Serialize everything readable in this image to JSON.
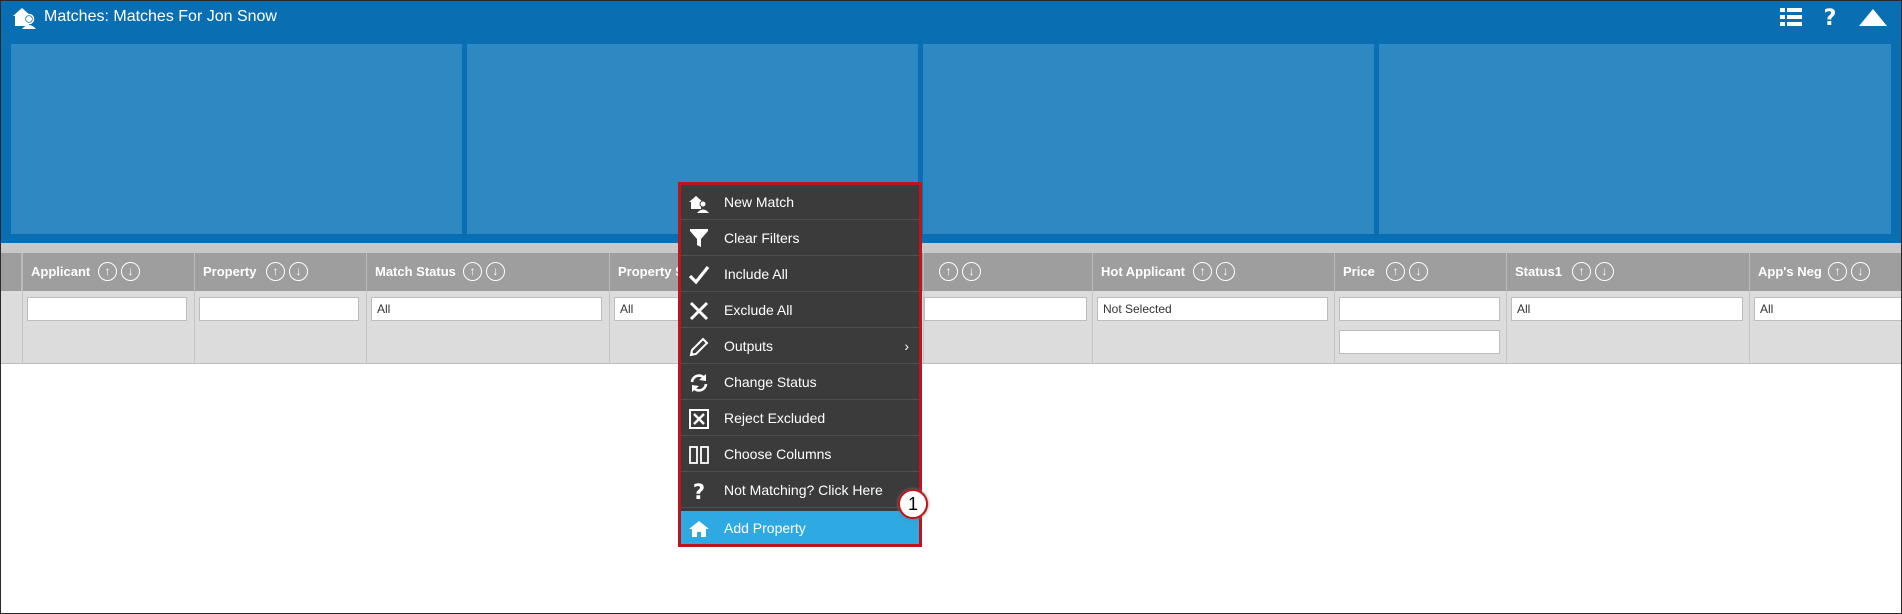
{
  "window": {
    "title": "Matches: Matches For Jon Snow"
  },
  "header_icons": [
    "list-view-icon",
    "help-icon",
    "collapse-up-icon"
  ],
  "colors": {
    "header": "#0a6fb2",
    "tile": "#2e88c2",
    "grid_header": "#9e9e9e",
    "menu_bg": "#3b3b3b",
    "menu_active": "#2ea9e2",
    "highlight": "#c0141b"
  },
  "columns": [
    {
      "title": "Applicant",
      "filter": ""
    },
    {
      "title": "Property",
      "filter": ""
    },
    {
      "title": "Match Status",
      "filter": "All"
    },
    {
      "title": "Property St",
      "filter": "All"
    },
    {
      "title": "",
      "filter": ""
    },
    {
      "title": "Hot Applicant",
      "filter": "Not Selected"
    },
    {
      "title": "Price",
      "filter": "",
      "filter2": ""
    },
    {
      "title": "Status1",
      "filter": "All"
    },
    {
      "title": "App's Neg",
      "filter": "All"
    }
  ],
  "menu": {
    "items": [
      {
        "label": "New Match",
        "icon": "new-match-icon"
      },
      {
        "label": "Clear Filters",
        "icon": "filter-icon"
      },
      {
        "label": "Include All",
        "icon": "checkmark-icon"
      },
      {
        "label": "Exclude All",
        "icon": "x-icon"
      },
      {
        "label": "Outputs",
        "icon": "pencil-icon",
        "submenu": "›"
      },
      {
        "label": "Change Status",
        "icon": "refresh-icon"
      },
      {
        "label": "Reject Excluded",
        "icon": "boxed-x-icon"
      },
      {
        "label": "Choose Columns",
        "icon": "columns-icon"
      },
      {
        "label": "Not Matching? Click Here",
        "icon": "question-icon"
      },
      {
        "label": "Add Property",
        "icon": "house-icon"
      }
    ],
    "callout": "1"
  },
  "sort_glyphs": {
    "up": "↑",
    "down": "↓"
  }
}
